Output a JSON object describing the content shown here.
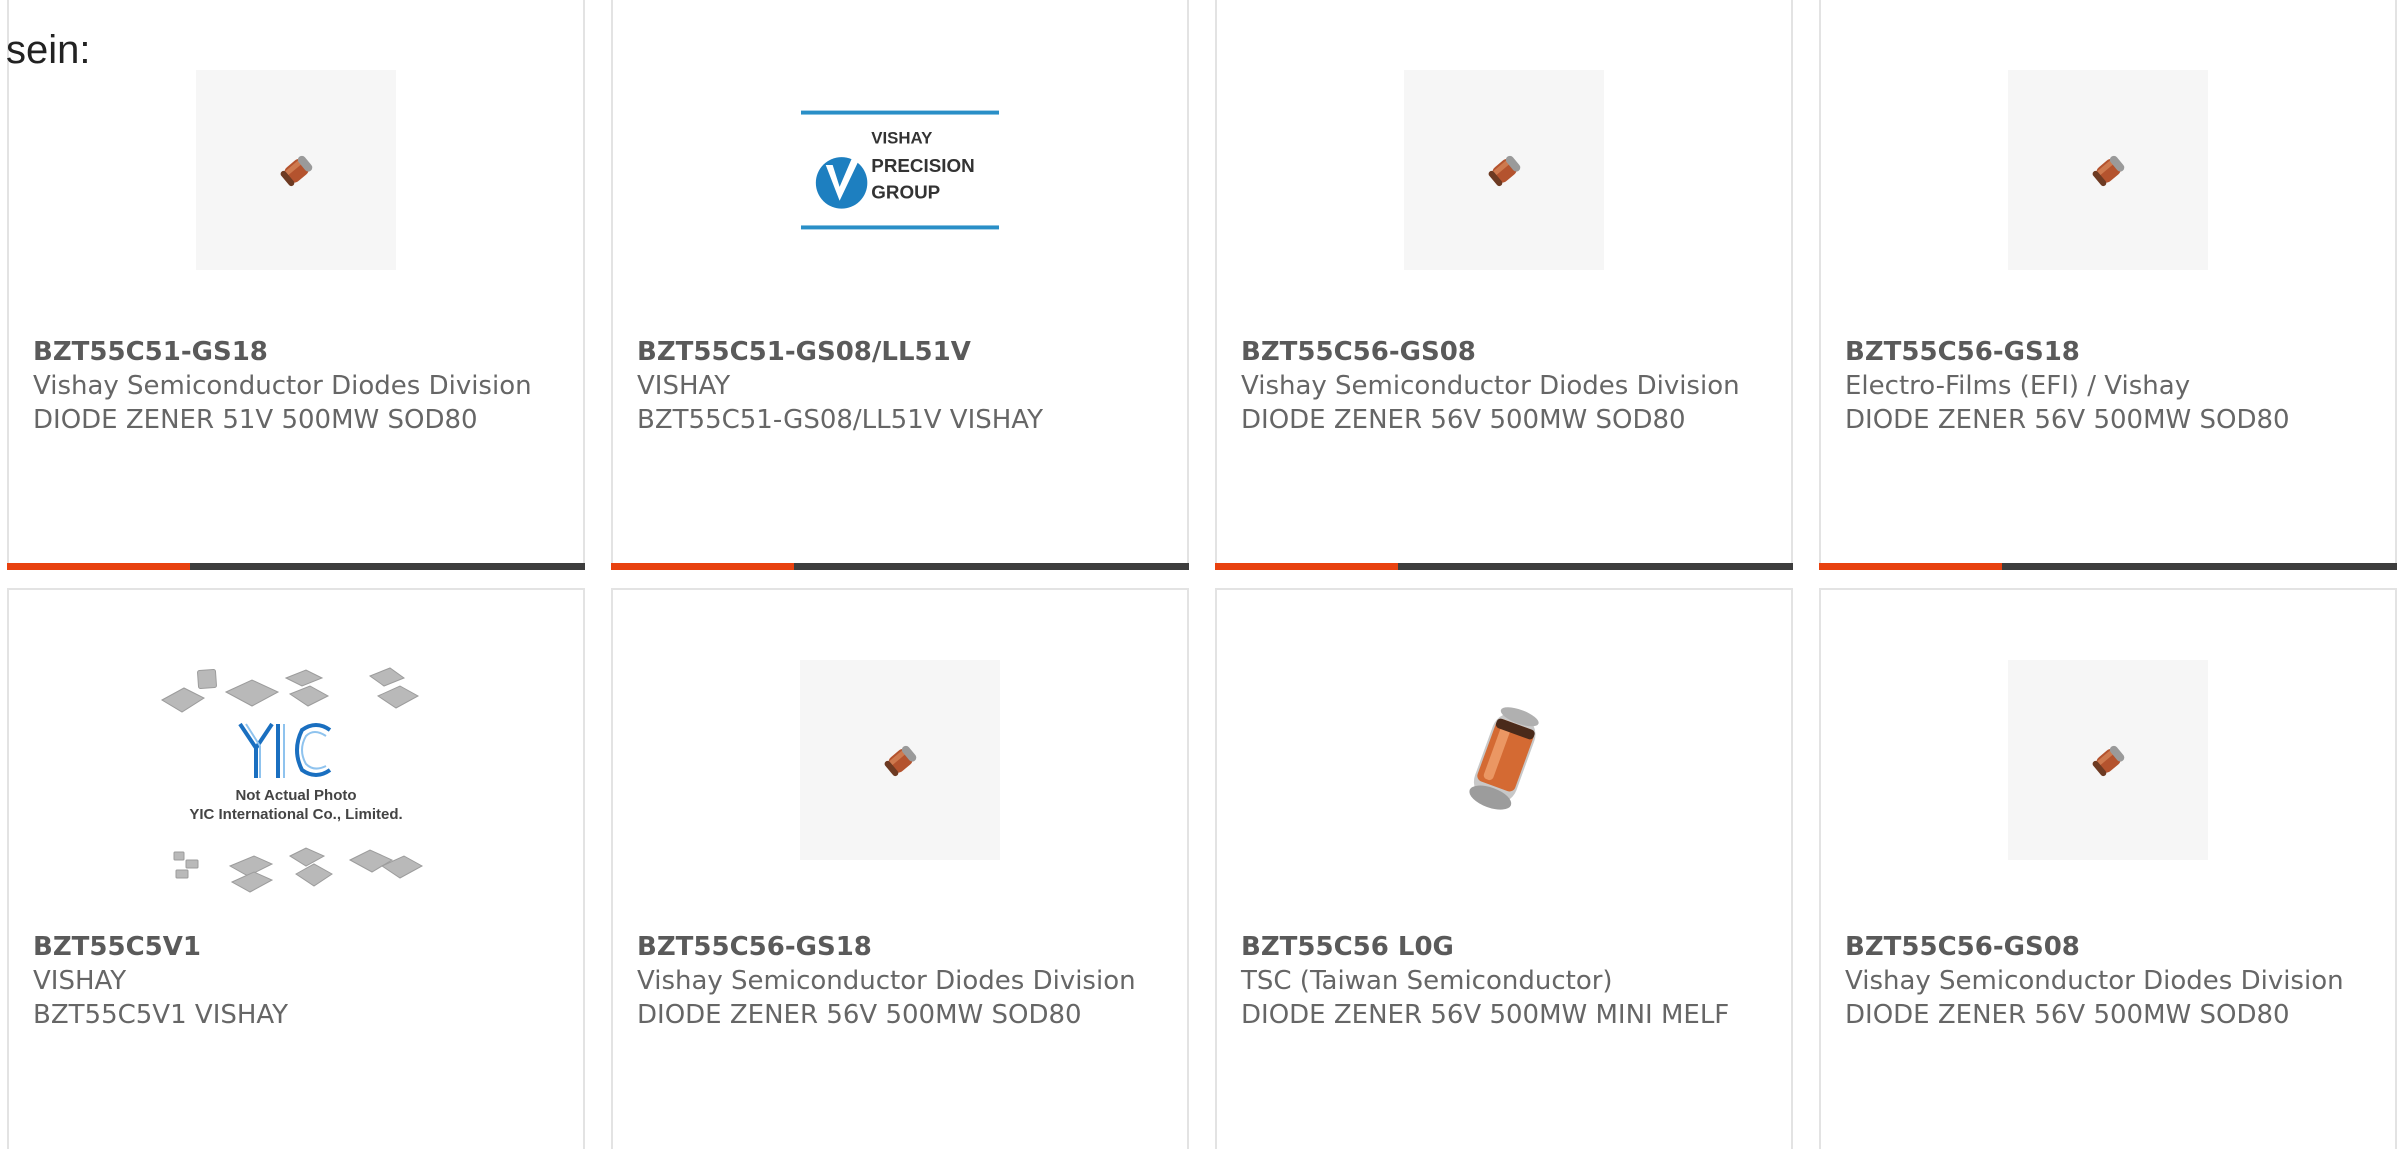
{
  "intro_text": "sein:",
  "colors": {
    "accent": "#e8410f",
    "bar": "#3d3d3d",
    "border": "#e3e3e3",
    "text": "#666666"
  },
  "products": [
    {
      "part_number": "BZT55C51-GS18",
      "manufacturer": "Vishay Semiconductor Diodes Division",
      "description": "DIODE ZENER 51V 500MW SOD80",
      "image": "small-diode-icon"
    },
    {
      "part_number": "BZT55C51-GS08/LL51V",
      "manufacturer": "VISHAY",
      "description": "BZT55C51-GS08/LL51V VISHAY",
      "image": "vishay-precision-group-logo",
      "logo_text": [
        "VISHAY",
        "PRECISION",
        "GROUP"
      ]
    },
    {
      "part_number": "BZT55C56-GS08",
      "manufacturer": "Vishay Semiconductor Diodes Division",
      "description": "DIODE ZENER 56V 500MW SOD80",
      "image": "small-diode-icon"
    },
    {
      "part_number": "BZT55C56-GS18",
      "manufacturer": "Electro-Films (EFI) / Vishay",
      "description": "DIODE ZENER 56V 500MW SOD80",
      "image": "small-diode-icon"
    },
    {
      "part_number": "BZT55C5V1",
      "manufacturer": "VISHAY",
      "description": "BZT55C5V1 VISHAY",
      "image": "yic-placeholder",
      "placeholder_text": [
        "Not Actual Photo",
        "YIC International Co., Limited."
      ]
    },
    {
      "part_number": "BZT55C56-GS18",
      "manufacturer": "Vishay Semiconductor Diodes Division",
      "description": "DIODE ZENER 56V 500MW SOD80",
      "image": "small-diode-icon"
    },
    {
      "part_number": "BZT55C56 L0G",
      "manufacturer": "TSC (Taiwan Semiconductor)",
      "description": "DIODE ZENER 56V 500MW MINI MELF",
      "image": "large-diode-icon"
    },
    {
      "part_number": "BZT55C56-GS08",
      "manufacturer": "Vishay Semiconductor Diodes Division",
      "description": "DIODE ZENER 56V 500MW SOD80",
      "image": "small-diode-icon"
    }
  ]
}
